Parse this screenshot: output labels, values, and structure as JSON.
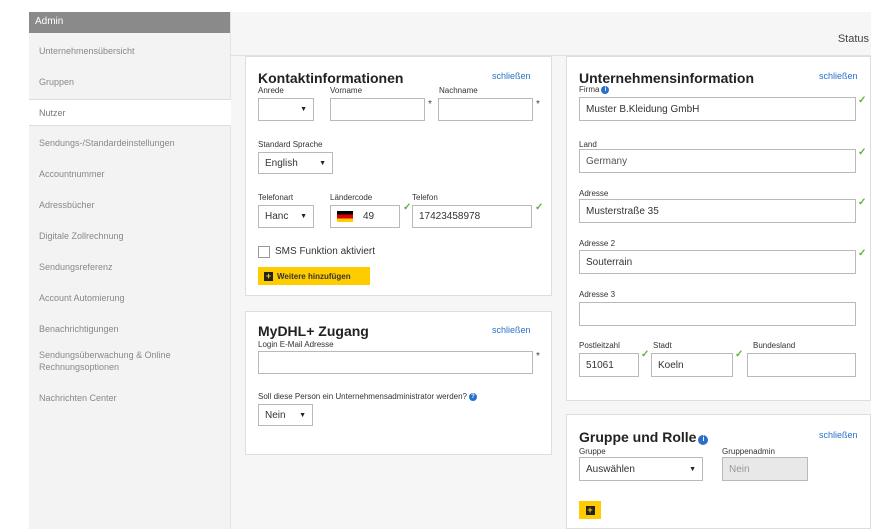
{
  "sidebar": {
    "header": "Admin",
    "items": [
      {
        "label": "Unternehmensübersicht"
      },
      {
        "label": "Gruppen"
      },
      {
        "label": "Nutzer"
      },
      {
        "label": "Sendungs-/Standardeinstellungen"
      },
      {
        "label": "Accountnummer"
      },
      {
        "label": "Adressbücher"
      },
      {
        "label": "Digitale Zollrechnung"
      },
      {
        "label": "Sendungsreferenz"
      },
      {
        "label": "Account Automierung"
      },
      {
        "label": "Benachrichtigungen"
      },
      {
        "label": "Sendungsüberwachung & Online Rechnungsoptionen"
      },
      {
        "label": "Nachrichten Center"
      }
    ]
  },
  "header": {
    "status_label": "Status"
  },
  "contact": {
    "title": "Kontaktinformationen",
    "close": "schließen",
    "anrede_label": "Anrede",
    "anrede_value": "",
    "vorname_label": "Vorname",
    "vorname_value": "",
    "nachname_label": "Nachname",
    "nachname_value": "",
    "required_mark": "*",
    "language_label": "Standard Sprache",
    "language_value": "English",
    "phone_type_label": "Telefonart",
    "phone_type_value": "Hanc",
    "country_code_label": "Ländercode",
    "country_code_value": "49",
    "phone_label": "Telefon",
    "phone_value": "17423458978",
    "sms_label": "SMS Funktion aktiviert",
    "sms_checked": false,
    "add_more_button": "Weitere hinzufügen"
  },
  "mydhl": {
    "title": "MyDHL+ Zugang",
    "close": "schließen",
    "email_label": "Login E-Mail Adresse",
    "email_value": "",
    "admin_question": "Soll diese Person ein Unternehmensadministrator werden?",
    "admin_value": "Nein"
  },
  "company": {
    "title": "Unternehmensinformation",
    "close": "schließen",
    "firma_label": "Firma",
    "firma_value": "Muster B.Kleidung GmbH",
    "land_label": "Land",
    "land_value": "Germany",
    "adresse_label": "Adresse",
    "adresse_value": "Musterstraße 35",
    "adresse2_label": "Adresse 2",
    "adresse2_value": "Souterrain",
    "adresse3_label": "Adresse 3",
    "adresse3_value": "",
    "plz_label": "Postleitzahl",
    "plz_value": "51061",
    "stadt_label": "Stadt",
    "stadt_value": "Koeln",
    "bundesland_label": "Bundesland",
    "bundesland_value": ""
  },
  "group_role": {
    "title": "Gruppe und Rolle",
    "close": "schließen",
    "gruppe_label": "Gruppe",
    "gruppe_value": "Auswählen",
    "gruppenadmin_label": "Gruppenadmin",
    "gruppenadmin_value": "Nein"
  },
  "colors": {
    "accent_yellow": "#ffcc00",
    "link_blue": "#2a70c9",
    "check_green": "#5bb53b"
  }
}
